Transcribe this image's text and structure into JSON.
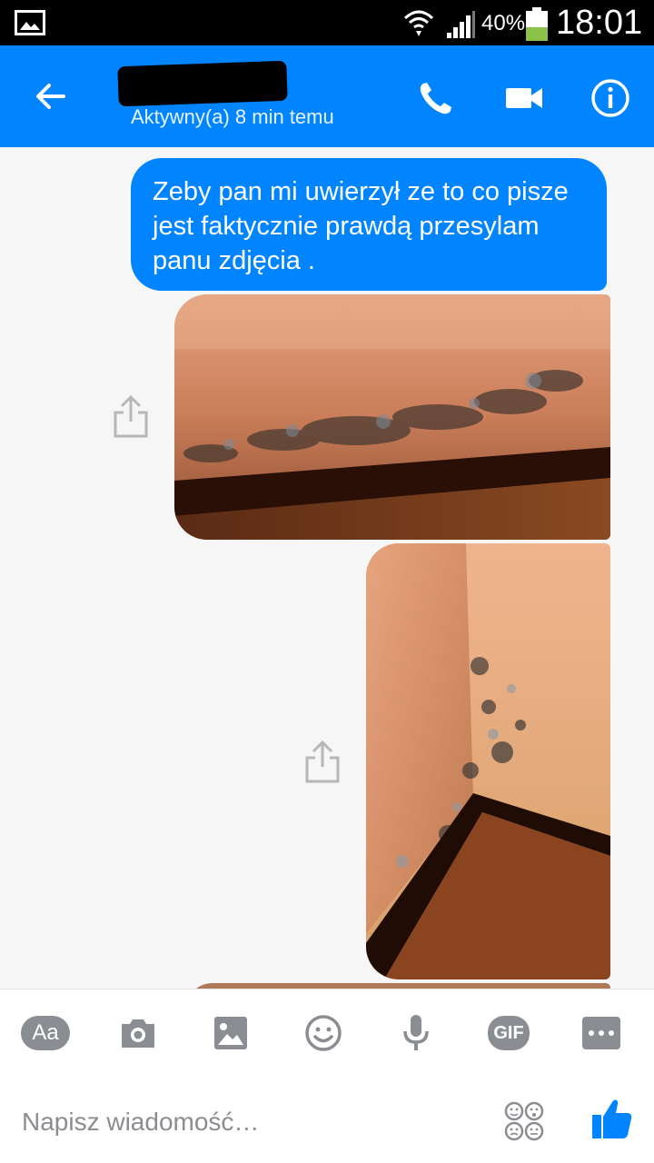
{
  "status_bar": {
    "battery_percent": "40%",
    "time": "18:01",
    "icons": [
      "gallery-icon",
      "wifi-icon",
      "signal-icon",
      "battery-icon"
    ]
  },
  "header": {
    "status": "Aktywny(a) 8 min temu",
    "icons": [
      "back-arrow-icon",
      "phone-icon",
      "video-camera-icon",
      "info-icon"
    ],
    "accent_color": "#0084ff"
  },
  "messages": [
    {
      "type": "text",
      "from": "me",
      "text": "Zeby pan mi uwierzył ze to co pisze jest faktycznie prawdą przesylam panu zdjęcia ."
    },
    {
      "type": "photo",
      "from": "me"
    },
    {
      "type": "photo",
      "from": "me"
    },
    {
      "type": "photo",
      "from": "me"
    }
  ],
  "composer": {
    "aa_label": "Aa",
    "gif_label": "GIF",
    "placeholder": "Napisz wiadomość…",
    "icons": [
      "aa-icon",
      "camera-icon",
      "image-icon",
      "emoji-icon",
      "microphone-icon",
      "gif-icon",
      "more-icon",
      "sticker-icon",
      "like-icon"
    ]
  }
}
